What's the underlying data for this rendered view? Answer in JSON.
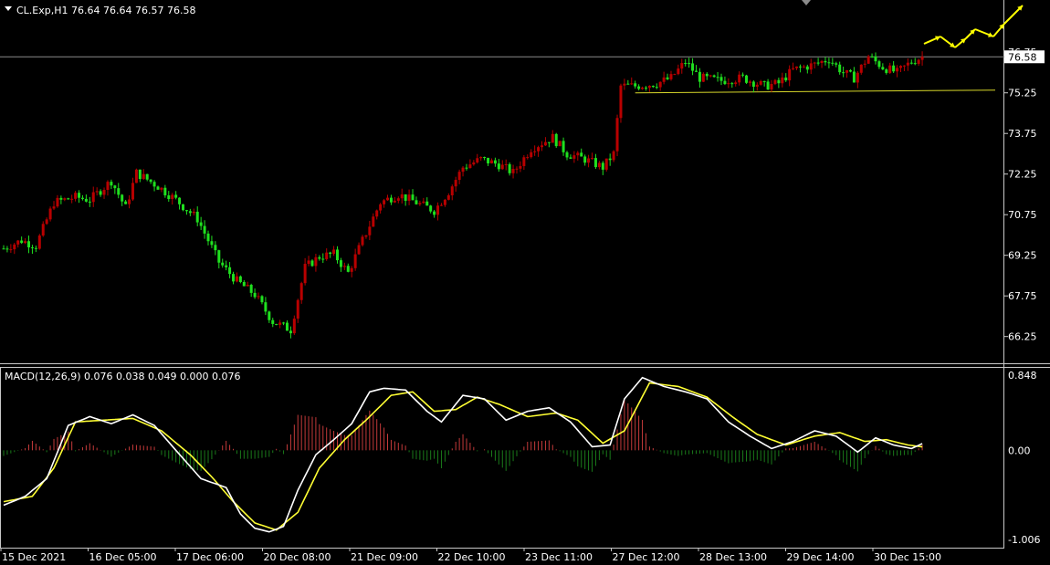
{
  "header": {
    "symbol_line": "CL.Exp,H1  76.64 76.64 76.57 76.58"
  },
  "macd_header": {
    "label": "MACD(12,26,9) 0.076 0.038 0.049 0.000 0.076"
  },
  "price_tag": "76.58",
  "x_ticks": [
    "15 Dec 2021",
    "16 Dec 05:00",
    "17 Dec 06:00",
    "20 Dec 08:00",
    "21 Dec 09:00",
    "22 Dec 10:00",
    "23 Dec 11:00",
    "27 Dec 12:00",
    "28 Dec 13:00",
    "29 Dec 14:00",
    "30 Dec 15:00"
  ],
  "colors": {
    "bull": "#b80000",
    "bear": "#1fe01f",
    "signal": "#ffff33",
    "macd": "#ffffff",
    "hist_pos": "#c43a3a",
    "hist_neg": "#1a7a1a",
    "arrow": "#ffff00"
  },
  "chart_data": [
    {
      "type": "candlestick",
      "title": "CL.Exp,H1",
      "y_ticks": [
        "76.75",
        "75.25",
        "73.75",
        "72.25",
        "70.75",
        "69.25",
        "67.75",
        "66.25"
      ],
      "ylim": [
        65.7,
        77.6
      ],
      "current_price": 76.58,
      "support_level": 75.3,
      "price_path": [
        {
          "bar": 0,
          "p": 69.5
        },
        {
          "bar": 5,
          "p": 69.8
        },
        {
          "bar": 9,
          "p": 69.6
        },
        {
          "bar": 14,
          "p": 71.2
        },
        {
          "bar": 20,
          "p": 71.4
        },
        {
          "bar": 24,
          "p": 71.3
        },
        {
          "bar": 30,
          "p": 72.0
        },
        {
          "bar": 34,
          "p": 71.0
        },
        {
          "bar": 37,
          "p": 72.3
        },
        {
          "bar": 43,
          "p": 71.8
        },
        {
          "bar": 48,
          "p": 71.3
        },
        {
          "bar": 54,
          "p": 70.6
        },
        {
          "bar": 60,
          "p": 69.0
        },
        {
          "bar": 65,
          "p": 68.3
        },
        {
          "bar": 70,
          "p": 67.8
        },
        {
          "bar": 75,
          "p": 66.8
        },
        {
          "bar": 80,
          "p": 66.5
        },
        {
          "bar": 84,
          "p": 68.8
        },
        {
          "bar": 88,
          "p": 69.2
        },
        {
          "bar": 92,
          "p": 69.3
        },
        {
          "bar": 96,
          "p": 68.6
        },
        {
          "bar": 100,
          "p": 69.8
        },
        {
          "bar": 105,
          "p": 71.2
        },
        {
          "bar": 110,
          "p": 71.5
        },
        {
          "bar": 115,
          "p": 71.2
        },
        {
          "bar": 120,
          "p": 70.9
        },
        {
          "bar": 124,
          "p": 71.6
        },
        {
          "bar": 128,
          "p": 72.5
        },
        {
          "bar": 133,
          "p": 72.8
        },
        {
          "bar": 138,
          "p": 72.6
        },
        {
          "bar": 142,
          "p": 72.3
        },
        {
          "bar": 147,
          "p": 73.2
        },
        {
          "bar": 153,
          "p": 73.6
        },
        {
          "bar": 157,
          "p": 73.0
        },
        {
          "bar": 162,
          "p": 72.8
        },
        {
          "bar": 167,
          "p": 72.5
        },
        {
          "bar": 170,
          "p": 73.0
        },
        {
          "bar": 172,
          "p": 75.5
        },
        {
          "bar": 176,
          "p": 75.5
        },
        {
          "bar": 182,
          "p": 75.6
        },
        {
          "bar": 186,
          "p": 75.8
        },
        {
          "bar": 190,
          "p": 76.4
        },
        {
          "bar": 194,
          "p": 75.8
        },
        {
          "bar": 200,
          "p": 75.7
        },
        {
          "bar": 206,
          "p": 75.8
        },
        {
          "bar": 212,
          "p": 75.5
        },
        {
          "bar": 216,
          "p": 75.6
        },
        {
          "bar": 220,
          "p": 76.1
        },
        {
          "bar": 226,
          "p": 76.3
        },
        {
          "bar": 230,
          "p": 76.5
        },
        {
          "bar": 234,
          "p": 76.0
        },
        {
          "bar": 237,
          "p": 75.8
        },
        {
          "bar": 241,
          "p": 76.6
        },
        {
          "bar": 245,
          "p": 76.2
        },
        {
          "bar": 249,
          "p": 76.0
        },
        {
          "bar": 253,
          "p": 76.4
        },
        {
          "bar": 256,
          "p": 76.58
        }
      ]
    },
    {
      "type": "line",
      "title": "MACD(12,26,9)",
      "y_ticks": [
        "0.848",
        "0.00",
        "-1.006"
      ],
      "ylim": [
        -1.006,
        0.848
      ],
      "series": [
        {
          "name": "MACD",
          "values": [
            {
              "bar": 0,
              "v": -0.62
            },
            {
              "bar": 6,
              "v": -0.52
            },
            {
              "bar": 12,
              "v": -0.32
            },
            {
              "bar": 18,
              "v": 0.28
            },
            {
              "bar": 24,
              "v": 0.38
            },
            {
              "bar": 30,
              "v": 0.3
            },
            {
              "bar": 36,
              "v": 0.4
            },
            {
              "bar": 42,
              "v": 0.28
            },
            {
              "bar": 48,
              "v": 0.0
            },
            {
              "bar": 55,
              "v": -0.32
            },
            {
              "bar": 62,
              "v": -0.42
            },
            {
              "bar": 66,
              "v": -0.72
            },
            {
              "bar": 70,
              "v": -0.88
            },
            {
              "bar": 74,
              "v": -0.92
            },
            {
              "bar": 78,
              "v": -0.86
            },
            {
              "bar": 82,
              "v": -0.45
            },
            {
              "bar": 87,
              "v": -0.05
            },
            {
              "bar": 92,
              "v": 0.12
            },
            {
              "bar": 97,
              "v": 0.3
            },
            {
              "bar": 102,
              "v": 0.66
            },
            {
              "bar": 106,
              "v": 0.7
            },
            {
              "bar": 112,
              "v": 0.68
            },
            {
              "bar": 118,
              "v": 0.44
            },
            {
              "bar": 122,
              "v": 0.32
            },
            {
              "bar": 128,
              "v": 0.62
            },
            {
              "bar": 134,
              "v": 0.58
            },
            {
              "bar": 140,
              "v": 0.34
            },
            {
              "bar": 146,
              "v": 0.44
            },
            {
              "bar": 152,
              "v": 0.48
            },
            {
              "bar": 158,
              "v": 0.32
            },
            {
              "bar": 164,
              "v": 0.04
            },
            {
              "bar": 169,
              "v": 0.06
            },
            {
              "bar": 173,
              "v": 0.58
            },
            {
              "bar": 178,
              "v": 0.82
            },
            {
              "bar": 184,
              "v": 0.72
            },
            {
              "bar": 190,
              "v": 0.66
            },
            {
              "bar": 196,
              "v": 0.58
            },
            {
              "bar": 202,
              "v": 0.32
            },
            {
              "bar": 208,
              "v": 0.16
            },
            {
              "bar": 214,
              "v": 0.02
            },
            {
              "bar": 220,
              "v": 0.1
            },
            {
              "bar": 226,
              "v": 0.22
            },
            {
              "bar": 232,
              "v": 0.16
            },
            {
              "bar": 238,
              "v": -0.02
            },
            {
              "bar": 243,
              "v": 0.14
            },
            {
              "bar": 248,
              "v": 0.06
            },
            {
              "bar": 253,
              "v": 0.02
            },
            {
              "bar": 256,
              "v": 0.076
            }
          ]
        },
        {
          "name": "Signal",
          "values": [
            {
              "bar": 0,
              "v": -0.58
            },
            {
              "bar": 8,
              "v": -0.52
            },
            {
              "bar": 14,
              "v": -0.2
            },
            {
              "bar": 20,
              "v": 0.32
            },
            {
              "bar": 28,
              "v": 0.34
            },
            {
              "bar": 36,
              "v": 0.36
            },
            {
              "bar": 44,
              "v": 0.22
            },
            {
              "bar": 52,
              "v": -0.05
            },
            {
              "bar": 58,
              "v": -0.3
            },
            {
              "bar": 64,
              "v": -0.58
            },
            {
              "bar": 70,
              "v": -0.82
            },
            {
              "bar": 76,
              "v": -0.9
            },
            {
              "bar": 82,
              "v": -0.7
            },
            {
              "bar": 88,
              "v": -0.2
            },
            {
              "bar": 95,
              "v": 0.12
            },
            {
              "bar": 101,
              "v": 0.34
            },
            {
              "bar": 108,
              "v": 0.62
            },
            {
              "bar": 114,
              "v": 0.66
            },
            {
              "bar": 120,
              "v": 0.44
            },
            {
              "bar": 126,
              "v": 0.46
            },
            {
              "bar": 132,
              "v": 0.6
            },
            {
              "bar": 138,
              "v": 0.52
            },
            {
              "bar": 146,
              "v": 0.38
            },
            {
              "bar": 154,
              "v": 0.42
            },
            {
              "bar": 160,
              "v": 0.34
            },
            {
              "bar": 167,
              "v": 0.08
            },
            {
              "bar": 173,
              "v": 0.22
            },
            {
              "bar": 180,
              "v": 0.76
            },
            {
              "bar": 188,
              "v": 0.72
            },
            {
              "bar": 196,
              "v": 0.6
            },
            {
              "bar": 203,
              "v": 0.38
            },
            {
              "bar": 210,
              "v": 0.18
            },
            {
              "bar": 218,
              "v": 0.06
            },
            {
              "bar": 226,
              "v": 0.16
            },
            {
              "bar": 233,
              "v": 0.2
            },
            {
              "bar": 240,
              "v": 0.1
            },
            {
              "bar": 246,
              "v": 0.12
            },
            {
              "bar": 252,
              "v": 0.06
            },
            {
              "bar": 256,
              "v": 0.038
            }
          ]
        }
      ]
    }
  ]
}
